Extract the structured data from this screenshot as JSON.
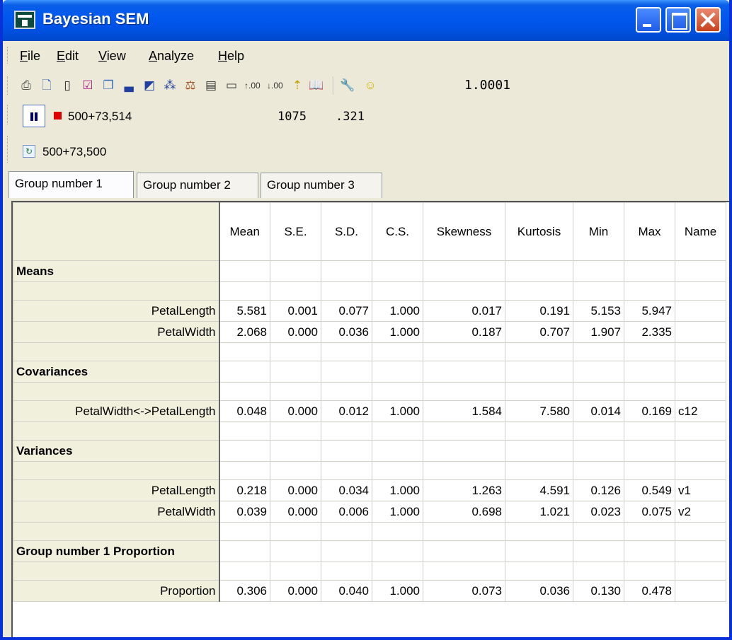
{
  "window": {
    "title": "Bayesian SEM"
  },
  "menu": [
    "File",
    "Edit",
    "View",
    "Analyze",
    "Help"
  ],
  "toolbar": {
    "icons": [
      "print-icon",
      "print-preview-icon",
      "copy-icon",
      "checkbox-icon",
      "copy-to-clipboard-icon",
      "histogram-icon",
      "picture-icon",
      "posterior-icon",
      "balance-scale-icon",
      "table-icon",
      "display-icon",
      "increase-decimals-icon",
      "decrease-decimals-icon",
      "cursor-icon",
      "book-icon",
      "wrench-icon",
      "smiley-icon"
    ],
    "convergence_value": "1.0001"
  },
  "status": {
    "samples_label": "500+73,514",
    "count": "1075",
    "ratio": ".321",
    "refresh_label": "500+73,500"
  },
  "tabs": [
    "Group number 1",
    "Group number 2",
    "Group number 3"
  ],
  "active_tab": 0,
  "table": {
    "columns": [
      "Mean",
      "S.E.",
      "S.D.",
      "C.S.",
      "Skewness",
      "Kurtosis",
      "Min",
      "Max",
      "Name"
    ],
    "rows": [
      {
        "type": "section",
        "label": "Means"
      },
      {
        "type": "spacer"
      },
      {
        "type": "data",
        "label": "PetalLength",
        "values": [
          "5.581",
          "0.001",
          "0.077",
          "1.000",
          "0.017",
          "0.191",
          "5.153",
          "5.947",
          ""
        ]
      },
      {
        "type": "data",
        "label": "PetalWidth",
        "values": [
          "2.068",
          "0.000",
          "0.036",
          "1.000",
          "0.187",
          "0.707",
          "1.907",
          "2.335",
          ""
        ]
      },
      {
        "type": "spacer"
      },
      {
        "type": "section",
        "label": "Covariances"
      },
      {
        "type": "spacer"
      },
      {
        "type": "data",
        "label": "PetalWidth<->PetalLength",
        "values": [
          "0.048",
          "0.000",
          "0.012",
          "1.000",
          "1.584",
          "7.580",
          "0.014",
          "0.169",
          "c12"
        ]
      },
      {
        "type": "spacer"
      },
      {
        "type": "section",
        "label": "Variances"
      },
      {
        "type": "spacer"
      },
      {
        "type": "data",
        "label": "PetalLength",
        "values": [
          "0.218",
          "0.000",
          "0.034",
          "1.000",
          "1.263",
          "4.591",
          "0.126",
          "0.549",
          "v1"
        ]
      },
      {
        "type": "data",
        "label": "PetalWidth",
        "values": [
          "0.039",
          "0.000",
          "0.006",
          "1.000",
          "0.698",
          "1.021",
          "0.023",
          "0.075",
          "v2"
        ]
      },
      {
        "type": "spacer"
      },
      {
        "type": "section",
        "label": "Group number 1 Proportion"
      },
      {
        "type": "spacer"
      },
      {
        "type": "data",
        "label": "Proportion",
        "values": [
          "0.306",
          "0.000",
          "0.040",
          "1.000",
          "0.073",
          "0.036",
          "0.130",
          "0.478",
          ""
        ]
      }
    ]
  }
}
